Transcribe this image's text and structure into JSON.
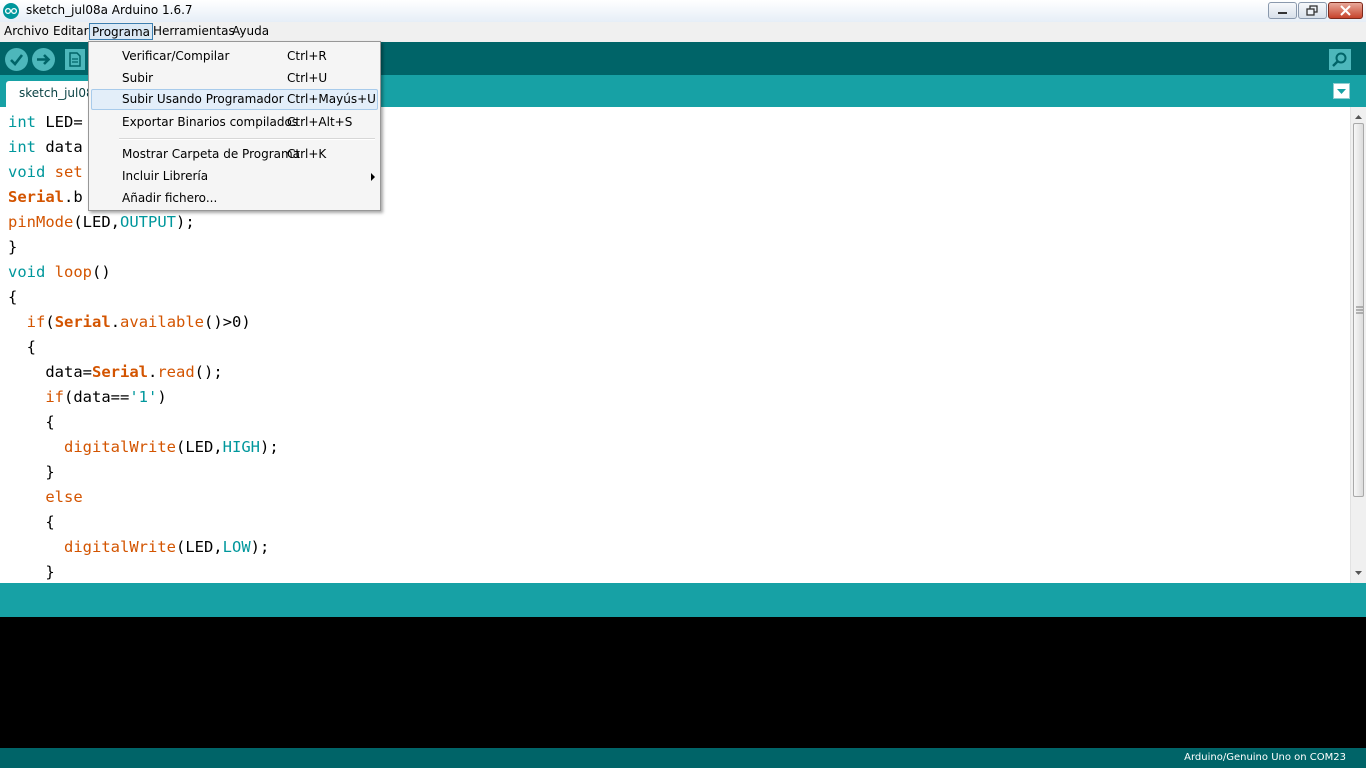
{
  "window": {
    "title": "sketch_jul08a Arduino 1.6.7"
  },
  "menubar": {
    "items": [
      "Archivo",
      "Editar",
      "Programa",
      "Herramientas",
      "Ayuda"
    ]
  },
  "tab": {
    "label": "sketch_jul08"
  },
  "dropdown": {
    "items": [
      {
        "label": "Verificar/Compilar",
        "shortcut": "Ctrl+R"
      },
      {
        "label": "Subir",
        "shortcut": "Ctrl+U"
      },
      {
        "label": "Subir Usando Programador",
        "shortcut": "Ctrl+Mayús+U"
      },
      {
        "label": "Exportar Binarios compilados",
        "shortcut": "Ctrl+Alt+S"
      },
      {
        "label": "Mostrar Carpeta de Programa",
        "shortcut": "Ctrl+K"
      },
      {
        "label": "Incluir Librería",
        "shortcut": ""
      },
      {
        "label": "Añadir fichero...",
        "shortcut": ""
      }
    ]
  },
  "code": {
    "lines": [
      {
        "indent": "",
        "tokens": [
          {
            "t": "int",
            "c": "kw"
          },
          {
            "t": " LED=",
            "c": ""
          }
        ]
      },
      {
        "indent": "",
        "tokens": [
          {
            "t": "int",
            "c": "kw"
          },
          {
            "t": " data",
            "c": ""
          }
        ]
      },
      {
        "indent": "",
        "tokens": [
          {
            "t": "void",
            "c": "kw"
          },
          {
            "t": " set",
            "c": "fn"
          }
        ]
      },
      {
        "indent": "",
        "tokens": [
          {
            "t": "Serial",
            "c": "fn bold"
          },
          {
            "t": ".b",
            "c": ""
          }
        ]
      },
      {
        "indent": "",
        "tokens": [
          {
            "t": "pinMode",
            "c": "fn"
          },
          {
            "t": "(LED,",
            "c": ""
          },
          {
            "t": "OUTPUT",
            "c": "kw"
          },
          {
            "t": ");",
            "c": ""
          }
        ]
      },
      {
        "indent": "",
        "tokens": [
          {
            "t": "}",
            "c": ""
          }
        ]
      },
      {
        "indent": "",
        "tokens": [
          {
            "t": "void",
            "c": "kw"
          },
          {
            "t": " ",
            "c": ""
          },
          {
            "t": "loop",
            "c": "fn"
          },
          {
            "t": "()",
            "c": ""
          }
        ]
      },
      {
        "indent": "",
        "tokens": [
          {
            "t": "{",
            "c": ""
          }
        ]
      },
      {
        "indent": "  ",
        "tokens": [
          {
            "t": "if",
            "c": "fn"
          },
          {
            "t": "(",
            "c": ""
          },
          {
            "t": "Serial",
            "c": "fn bold"
          },
          {
            "t": ".",
            "c": ""
          },
          {
            "t": "available",
            "c": "fn"
          },
          {
            "t": "()>0)",
            "c": ""
          }
        ]
      },
      {
        "indent": "  ",
        "tokens": [
          {
            "t": "{",
            "c": ""
          }
        ]
      },
      {
        "indent": "    ",
        "tokens": [
          {
            "t": "data=",
            "c": ""
          },
          {
            "t": "Serial",
            "c": "fn bold"
          },
          {
            "t": ".",
            "c": ""
          },
          {
            "t": "read",
            "c": "fn"
          },
          {
            "t": "();",
            "c": ""
          }
        ]
      },
      {
        "indent": "    ",
        "tokens": [
          {
            "t": "if",
            "c": "fn"
          },
          {
            "t": "(data==",
            "c": ""
          },
          {
            "t": "'1'",
            "c": "kw"
          },
          {
            "t": ")",
            "c": ""
          }
        ]
      },
      {
        "indent": "    ",
        "tokens": [
          {
            "t": "{",
            "c": ""
          }
        ]
      },
      {
        "indent": "      ",
        "tokens": [
          {
            "t": "digitalWrite",
            "c": "fn"
          },
          {
            "t": "(LED,",
            "c": ""
          },
          {
            "t": "HIGH",
            "c": "kw"
          },
          {
            "t": ");",
            "c": ""
          }
        ]
      },
      {
        "indent": "    ",
        "tokens": [
          {
            "t": "}",
            "c": ""
          }
        ]
      },
      {
        "indent": "    ",
        "tokens": [
          {
            "t": "else",
            "c": "fn"
          }
        ]
      },
      {
        "indent": "    ",
        "tokens": [
          {
            "t": "{",
            "c": ""
          }
        ]
      },
      {
        "indent": "      ",
        "tokens": [
          {
            "t": "digitalWrite",
            "c": "fn"
          },
          {
            "t": "(LED,",
            "c": ""
          },
          {
            "t": "LOW",
            "c": "kw"
          },
          {
            "t": ");",
            "c": ""
          }
        ]
      },
      {
        "indent": "    ",
        "tokens": [
          {
            "t": "}",
            "c": ""
          }
        ]
      }
    ]
  },
  "status": {
    "board": "Arduino/Genuino Uno on COM23"
  },
  "colors": {
    "toolbar": "#006468",
    "tabbar": "#17a1a5",
    "keyword": "#00979c",
    "function": "#d35400",
    "console": "#000000"
  }
}
